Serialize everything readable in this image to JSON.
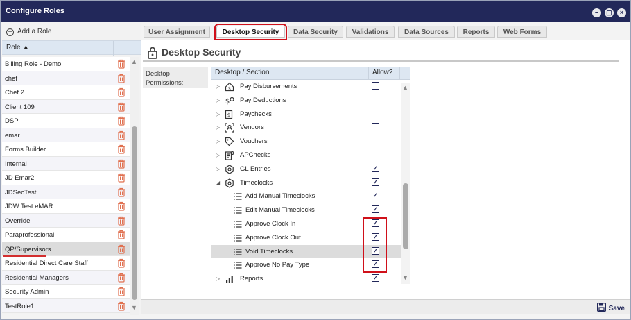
{
  "window": {
    "title": "Configure Roles"
  },
  "left": {
    "add_label": "Add a Role",
    "column_header": "Role",
    "roles": [
      "Billing Role - Demo",
      "chef",
      "Chef 2",
      "Client 109",
      "DSP",
      "emar",
      "Forms Builder",
      "Internal",
      "JD Emar2",
      "JDSecTest",
      "JDW Test eMAR",
      "Override",
      "Paraprofessional",
      "QP/Supervisors",
      "Residential Direct Care Staff",
      "Residential Managers",
      "Security Admin",
      "TestRole1"
    ],
    "selected": "QP/Supervisors"
  },
  "tabs": [
    "User Assignment",
    "Desktop Security",
    "Data Security",
    "Validations",
    "Data Sources",
    "Reports",
    "Web Forms"
  ],
  "active_tab": "Desktop Security",
  "section": {
    "title": "Desktop Security",
    "perm_label": "Desktop Permissions:",
    "col_section": "Desktop / Section",
    "col_allow": "Allow?",
    "rows": [
      {
        "label": "Pay Disbursements",
        "level": 1,
        "expander": "▷",
        "icon": "house-dollar-icon",
        "checked": false
      },
      {
        "label": "Pay Deductions",
        "level": 1,
        "expander": "▷",
        "icon": "dollar-gear-icon",
        "checked": false
      },
      {
        "label": "Paychecks",
        "level": 1,
        "expander": "▷",
        "icon": "paycheck-icon",
        "checked": false
      },
      {
        "label": "Vendors",
        "level": 1,
        "expander": "▷",
        "icon": "vendor-icon",
        "checked": false
      },
      {
        "label": "Vouchers",
        "level": 1,
        "expander": "▷",
        "icon": "tag-icon",
        "checked": false
      },
      {
        "label": "APChecks",
        "level": 1,
        "expander": "▷",
        "icon": "document-gear-icon",
        "checked": false
      },
      {
        "label": "GL Entries",
        "level": 1,
        "expander": "▷",
        "icon": "hexagon-icon",
        "checked": true
      },
      {
        "label": "Timeclocks",
        "level": 1,
        "expander": "◢",
        "icon": "hexagon-icon",
        "checked": true
      },
      {
        "label": "Add Manual Timeclocks",
        "level": 2,
        "expander": "",
        "icon": "list-icon",
        "checked": true
      },
      {
        "label": "Edit Manual Timeclocks",
        "level": 2,
        "expander": "",
        "icon": "list-icon",
        "checked": true
      },
      {
        "label": "Approve Clock In",
        "level": 2,
        "expander": "",
        "icon": "list-icon",
        "checked": true
      },
      {
        "label": "Approve Clock Out",
        "level": 2,
        "expander": "",
        "icon": "list-icon",
        "checked": true
      },
      {
        "label": "Void Timeclocks",
        "level": 2,
        "expander": "",
        "icon": "list-icon",
        "checked": true
      },
      {
        "label": "Approve No Pay Type",
        "level": 2,
        "expander": "",
        "icon": "list-icon",
        "checked": true
      },
      {
        "label": "Reports",
        "level": 1,
        "expander": "▷",
        "icon": "bar-chart-icon",
        "checked": true
      }
    ],
    "selected_row": "Void Timeclocks"
  },
  "bottom": {
    "save_label": "Save"
  },
  "colors": {
    "titlebar": "#22285a",
    "highlight": "#d0101a",
    "trash": "#e07050"
  }
}
